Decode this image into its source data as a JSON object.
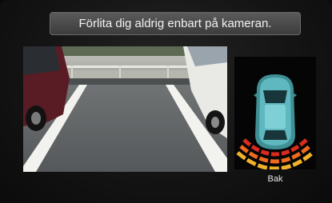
{
  "warning": {
    "text": "Förlita dig aldrig enbart på kameran."
  },
  "sensor": {
    "label": "Bak"
  },
  "colors": {
    "sensor_red": "#d92b1f",
    "sensor_orange": "#ee6a1f",
    "sensor_yellow": "#f0b22a",
    "car_body": "#4fa7ae"
  }
}
